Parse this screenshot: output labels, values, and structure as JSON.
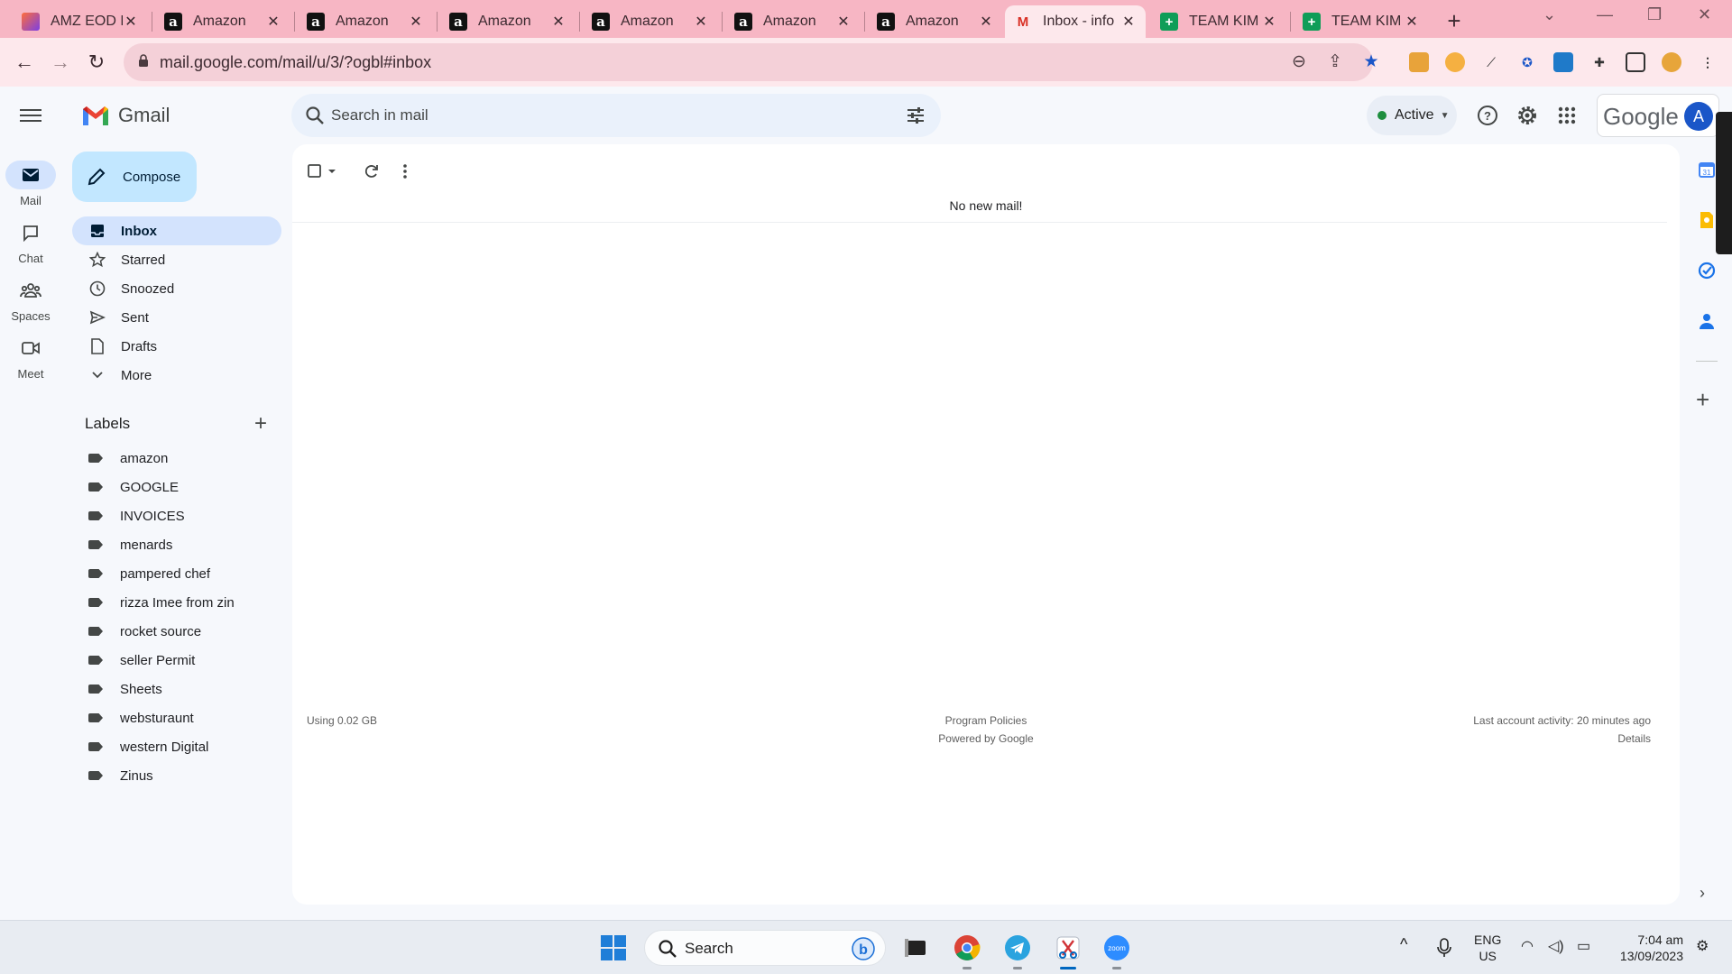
{
  "browser": {
    "tabs": [
      {
        "title": "AMZ EOD R",
        "icon": "amz-eod-icon",
        "active": false
      },
      {
        "title": "Amazon",
        "icon": "amazon-icon",
        "active": false
      },
      {
        "title": "Amazon",
        "icon": "amazon-icon",
        "active": false
      },
      {
        "title": "Amazon",
        "icon": "amazon-icon",
        "active": false
      },
      {
        "title": "Amazon",
        "icon": "amazon-icon",
        "active": false
      },
      {
        "title": "Amazon",
        "icon": "amazon-icon",
        "active": false
      },
      {
        "title": "Amazon",
        "icon": "amazon-icon",
        "active": false
      },
      {
        "title": "Inbox - info",
        "icon": "gmail-icon",
        "active": true
      },
      {
        "title": "TEAM KIM",
        "icon": "sheets-icon",
        "active": false
      },
      {
        "title": "TEAM KIM",
        "icon": "sheets-icon",
        "active": false
      }
    ],
    "url": "mail.google.com/mail/u/3/?ogbl#inbox",
    "tab_color": "#f7b6c4",
    "toolbar_color": "#fde8ec"
  },
  "gmail": {
    "app_name": "Gmail",
    "search_placeholder": "Search in mail",
    "status": "Active",
    "google_word": "Google",
    "avatar_letter": "A",
    "rail": [
      {
        "label": "Mail",
        "icon": "mail-icon",
        "selected": true
      },
      {
        "label": "Chat",
        "icon": "chat-icon",
        "selected": false
      },
      {
        "label": "Spaces",
        "icon": "spaces-icon",
        "selected": false
      },
      {
        "label": "Meet",
        "icon": "meet-icon",
        "selected": false
      }
    ],
    "compose_label": "Compose",
    "nav": [
      {
        "label": "Inbox",
        "icon": "inbox-icon",
        "selected": true
      },
      {
        "label": "Starred",
        "icon": "star-icon",
        "selected": false
      },
      {
        "label": "Snoozed",
        "icon": "clock-icon",
        "selected": false
      },
      {
        "label": "Sent",
        "icon": "send-icon",
        "selected": false
      },
      {
        "label": "Drafts",
        "icon": "draft-icon",
        "selected": false
      },
      {
        "label": "More",
        "icon": "chevron-down-icon",
        "selected": false
      }
    ],
    "labels_heading": "Labels",
    "labels": [
      "amazon",
      "GOOGLE",
      "INVOICES",
      "menards",
      "pampered chef",
      "rizza Imee from zin",
      "rocket source",
      "seller Permit",
      "Sheets",
      "websturaunt",
      "western Digital",
      "Zinus"
    ],
    "main": {
      "empty_message": "No new mail!",
      "storage": "Using 0.02 GB",
      "program_policies": "Program Policies",
      "powered_by": "Powered by Google",
      "last_activity": "Last account activity: 20 minutes ago",
      "details": "Details"
    },
    "accent_color": "#d3e3fd",
    "compose_color": "#c2e7ff"
  },
  "taskbar": {
    "search_label": "Search",
    "lang_top": "ENG",
    "lang_bottom": "US",
    "time": "7:04 am",
    "date": "13/09/2023"
  }
}
